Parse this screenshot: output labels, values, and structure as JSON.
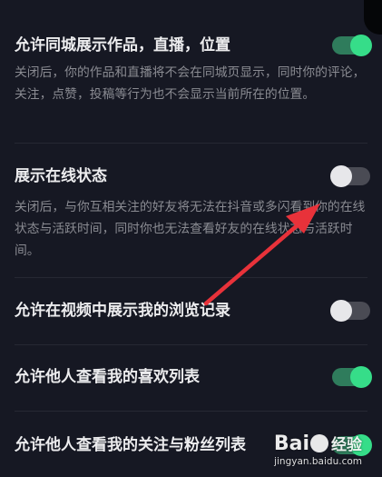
{
  "settings": [
    {
      "title": "允许同城展示作品，直播，位置",
      "description": "关闭后，你的作品和直播将不会在同城页显示，同时你的评论，关注，点赞，投稿等行为也不会显示当前所在的位置。",
      "enabled": true
    },
    {
      "title": "展示在线状态",
      "description": "关闭后，与你互相关注的好友将无法在抖音或多闪看到你的在线状态与活跃时间，同时你也无法查看好友的在线状态与活跃时间。",
      "enabled": false
    },
    {
      "title": "允许在视频中展示我的浏览记录",
      "enabled": false
    },
    {
      "title": "允许他人查看我的喜欢列表",
      "enabled": true
    },
    {
      "title": "允许他人查看我的关注与粉丝列表",
      "enabled": true
    }
  ],
  "colors": {
    "background": "#161823",
    "toggle_on_track": "#2f7c5c",
    "toggle_on_knob": "#36dd89",
    "toggle_off_track": "#4a4b54",
    "toggle_off_knob": "#e7e7ea",
    "annotation_arrow": "#e8323a"
  },
  "annotation": {
    "type": "arrow",
    "points_to": "展示在线状态 toggle"
  },
  "watermark": {
    "logo_text": "Baidu 经验",
    "url": "jingyan.baidu.com"
  }
}
